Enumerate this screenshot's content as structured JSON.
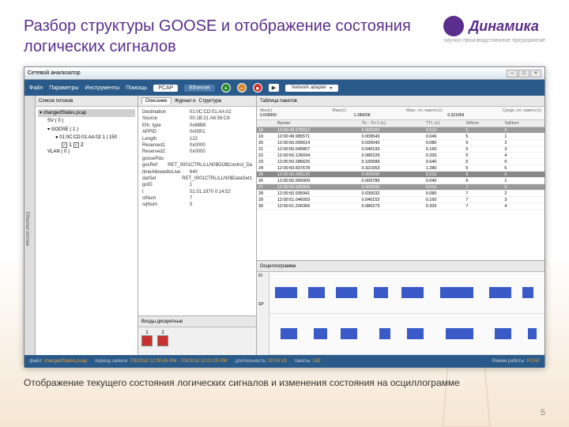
{
  "slide": {
    "title": "Разбор структуры GOOSE и отображение состояния логических сигналов",
    "caption": "Отображение текущего состояния логических сигналов и изменения состояния на осциллограмме",
    "pagenum": "5"
  },
  "logo": {
    "brand": "Динамика",
    "sub": "научно-производственное предприятие"
  },
  "app": {
    "title": "Сетевой анализатор",
    "menu": {
      "file": "Файл",
      "params": "Параметры",
      "tools": "Инструменты",
      "help": "Помощь"
    },
    "toolbar": {
      "pcap": "PCAP",
      "eth": "Ethernet",
      "adapter": "Network adapter"
    },
    "sidebar_tab": "Ethernet потоки",
    "streams": {
      "title": "Список потоков",
      "file": "changedStates.pcap",
      "sv": "SV ( 0 )",
      "goose": "GOOSE ( 1 )",
      "mac": "01:0C:CD:01:AA:02  1  | 150",
      "c1": "1",
      "c2": "2",
      "vlan": "VLAN ( 0 )"
    },
    "desc": {
      "title": "Описание",
      "tab2": "Журнал и",
      "tab3": "Структура",
      "rows": [
        {
          "k": "Destination",
          "v": "01:0C:CD:01:AA:02"
        },
        {
          "k": "Source",
          "v": "00:1B:21:A6:59:C6"
        },
        {
          "k": "Eth. type",
          "v": "0x88B8"
        },
        {
          "k": "APPID",
          "v": "0x0001"
        },
        {
          "k": "Length",
          "v": "122"
        },
        {
          "k": "Reserved1",
          "v": "0x0000"
        },
        {
          "k": "Reserved2",
          "v": "0x0000"
        },
        {
          "k": "goosePdu",
          "v": ""
        },
        {
          "k": "  gocRef",
          "v": "RET_0001CTRL/LLN0$GO$Control_Da"
        },
        {
          "k": "  timeAllowedtoLive",
          "v": "640"
        },
        {
          "k": "  datSet",
          "v": "RET_0001CTRL/LLN0$DataSet1"
        },
        {
          "k": "  goID",
          "v": "1"
        },
        {
          "k": "  t",
          "v": "01.01.1970 0:14:52"
        },
        {
          "k": "  stNum",
          "v": "7"
        },
        {
          "k": "  sqNum",
          "v": "5"
        }
      ]
    },
    "discrete": {
      "title": "Входы дискретные",
      "b1": "1",
      "b2": "2"
    },
    "packets": {
      "title": "Таблица пакетов",
      "timeline": {
        "l0": "0.000000",
        "mn": "Мин(с)",
        "l1": "1.284206",
        "mx": "Макс(с)",
        "l2": "0.321654",
        "ml": "Макс. отг. пакета (с)",
        "mr": "Средн. отг. пакета (с)"
      },
      "cols": {
        "n": "",
        "t": "Время",
        "tn": "Tn - Tn-1 (с)",
        "ttl": "TTL (с)",
        "st": "StNum",
        "sq": "SqNum"
      },
      "rows": [
        {
          "n": "18",
          "t": "12:00:49.978013",
          "tn": "0.000000",
          "ttl": "0.010",
          "st": "5",
          "sq": "0",
          "cls": "dk"
        },
        {
          "n": "19",
          "t": "12:00:49.985571",
          "tn": "0.009543",
          "ttl": "0.040",
          "st": "5",
          "sq": "1"
        },
        {
          "n": "20",
          "t": "12:00:50.005614",
          "tn": "0.020043",
          "ttl": "0.080",
          "st": "5",
          "sq": "2"
        },
        {
          "n": "21",
          "t": "12:00:50.045807",
          "tn": "0.040193",
          "ttl": "0.160",
          "st": "5",
          "sq": "3"
        },
        {
          "n": "22",
          "t": "12:00:50.126034",
          "tn": "0.080229",
          "ttl": "0.320",
          "st": "5",
          "sq": "4"
        },
        {
          "n": "23",
          "t": "12:00:50.286625",
          "tn": "0.160589",
          "ttl": "0.640",
          "st": "5",
          "sq": "5"
        },
        {
          "n": "24",
          "t": "12:00:50.607678",
          "tn": "0.321053",
          "ttl": "1.280",
          "st": "5",
          "sq": "6"
        },
        {
          "n": "25",
          "t": "12:00:50.905120",
          "tn": "0.000000",
          "ttl": "0.010",
          "st": "6",
          "sq": "0",
          "cls": "sel"
        },
        {
          "n": "26",
          "t": "12:00:50.905909",
          "tn": "0.000789",
          "ttl": "0.040",
          "st": "6",
          "sq": "1"
        },
        {
          "n": "27",
          "t": "12:00:50.905909",
          "tn": "0.000000",
          "ttl": "0.010",
          "st": "7",
          "sq": "0",
          "cls": "dk"
        },
        {
          "n": "28",
          "t": "12:00:50.935941",
          "tn": "0.030032",
          "ttl": "0.080",
          "st": "7",
          "sq": "2"
        },
        {
          "n": "29",
          "t": "12:00:51.046093",
          "tn": "0.040152",
          "ttl": "0.160",
          "st": "7",
          "sq": "3"
        },
        {
          "n": "30",
          "t": "12:00:51.206366",
          "tn": "0.080273",
          "ttl": "0.320",
          "st": "7",
          "sq": "4"
        }
      ]
    },
    "oscillo": {
      "title": "Осциллограмма",
      "r1": "Dl",
      "r2": "SP"
    },
    "status": {
      "file_l": "файл:",
      "file_v": "changedStates.pcap",
      "period_l": "период записи:",
      "period_v": "7/9/2018 12:00:45 PM - 7/9/2018 12:01:05 PM",
      "dur_l": "длительность:",
      "dur_v": "00:00:19",
      "pkts_l": "пакеты:",
      "pkts_v": "150",
      "mode_l": "Режим работы:",
      "mode_v": "PCAP"
    }
  }
}
